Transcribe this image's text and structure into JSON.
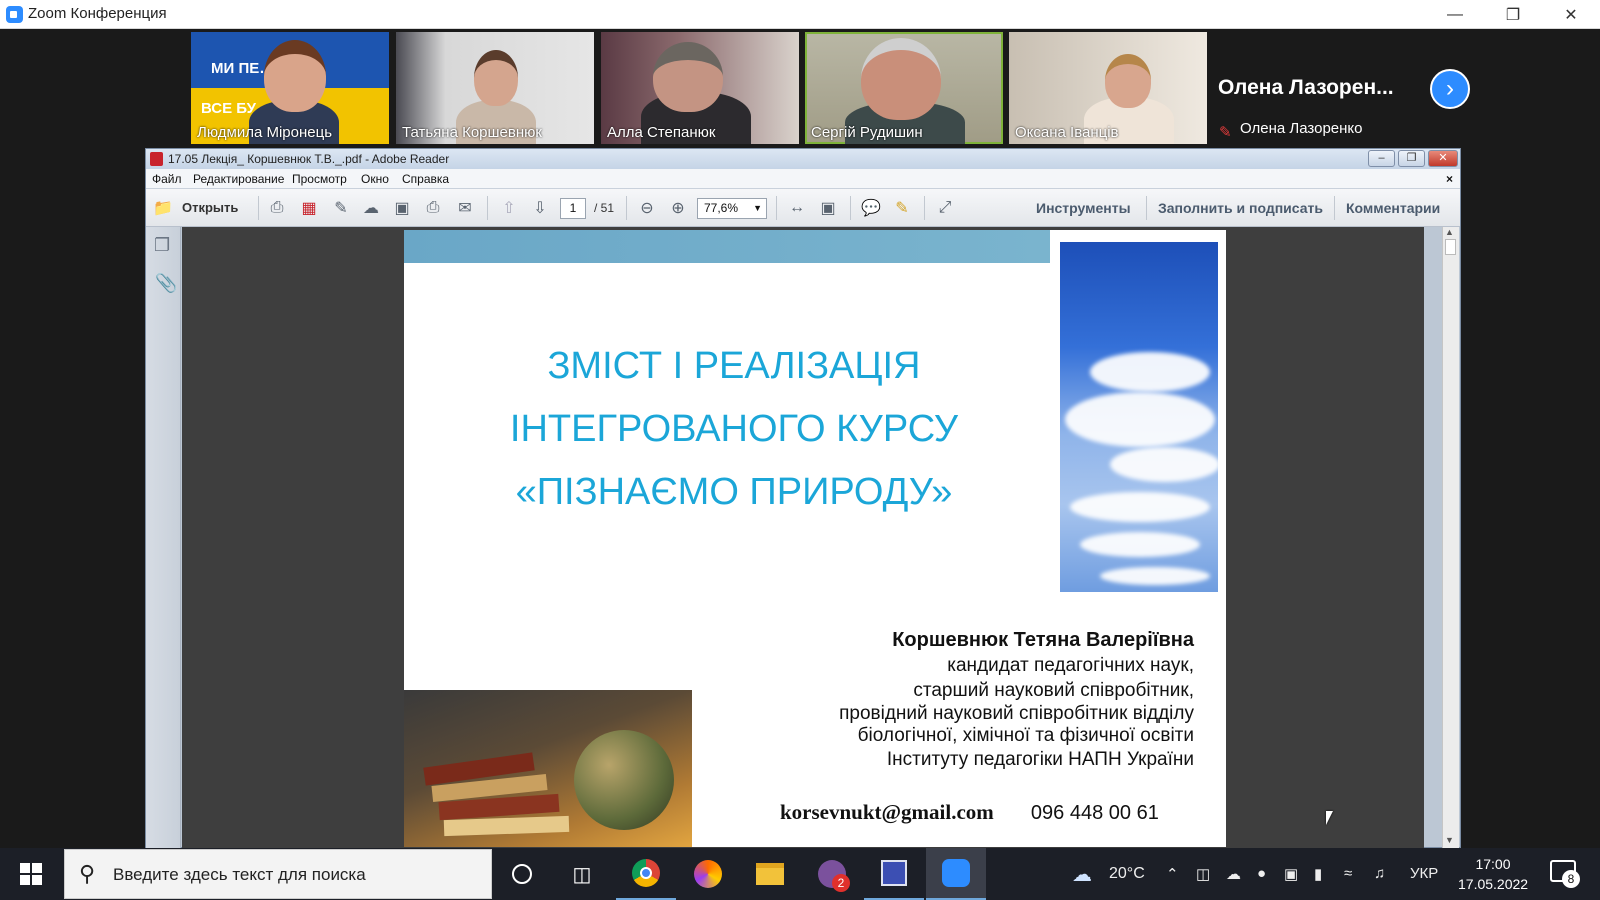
{
  "zoom": {
    "title": "Zoom Конференция",
    "participants": [
      {
        "name": "Людмила Міронець",
        "banner_top": "МИ ПЕ…ЕМО!",
        "banner_bottom": "ВСЕ БУ…АЇНА!"
      },
      {
        "name": "Татьяна Коршевнюк"
      },
      {
        "name": "Алла Степанюк"
      },
      {
        "name": "Сергій Рудишин",
        "active": true
      },
      {
        "name": "Оксана Іванців"
      },
      {
        "name": "Олена Лазоренко",
        "display_name": "Олена  Лазорен...",
        "muted": true
      }
    ]
  },
  "reader": {
    "title": "17.05 Лекція_ Коршевнюк Т.В._.pdf - Adobe Reader",
    "menu": [
      "Файл",
      "Редактирование",
      "Просмотр",
      "Окно",
      "Справка"
    ],
    "open_label": "Открыть",
    "page_current": "1",
    "page_total": "/ 51",
    "zoom_level": "77,6%",
    "tools_label": "Инструменты",
    "fill_sign_label": "Заполнить и подписать",
    "comments_label": "Комментарии"
  },
  "slide": {
    "title_lines": [
      "ЗМІСТ І РЕАЛІЗАЦІЯ",
      "ІНТЕГРОВАНОГО КУРСУ",
      "«ПІЗНАЄМО ПРИРОДУ»"
    ],
    "author_name": "Коршевнюк Тетяна  Валеріївна",
    "author_lines": [
      "кандидат педагогічних наук,",
      "старший науковий співробітник,",
      "провідний науковий співробітник відділу",
      "біологічної, хімічної та фізичної освіти",
      "Інституту педагогіки НАПН України"
    ],
    "email": "korsevnukt@gmail.com",
    "phone": "096 448 00 61"
  },
  "taskbar": {
    "search_placeholder": "Введите здесь текст для поиска",
    "viber_badge": "2",
    "weather": "20°C",
    "language": "УКР",
    "time": "17:00",
    "date": "17.05.2022",
    "notifications": "8"
  },
  "colors": {
    "zoom_blue": "#2d8cff",
    "slide_title": "#1ba6d8",
    "slide_bar": "#6aa7c7",
    "active_speaker": "#7fb33a"
  }
}
